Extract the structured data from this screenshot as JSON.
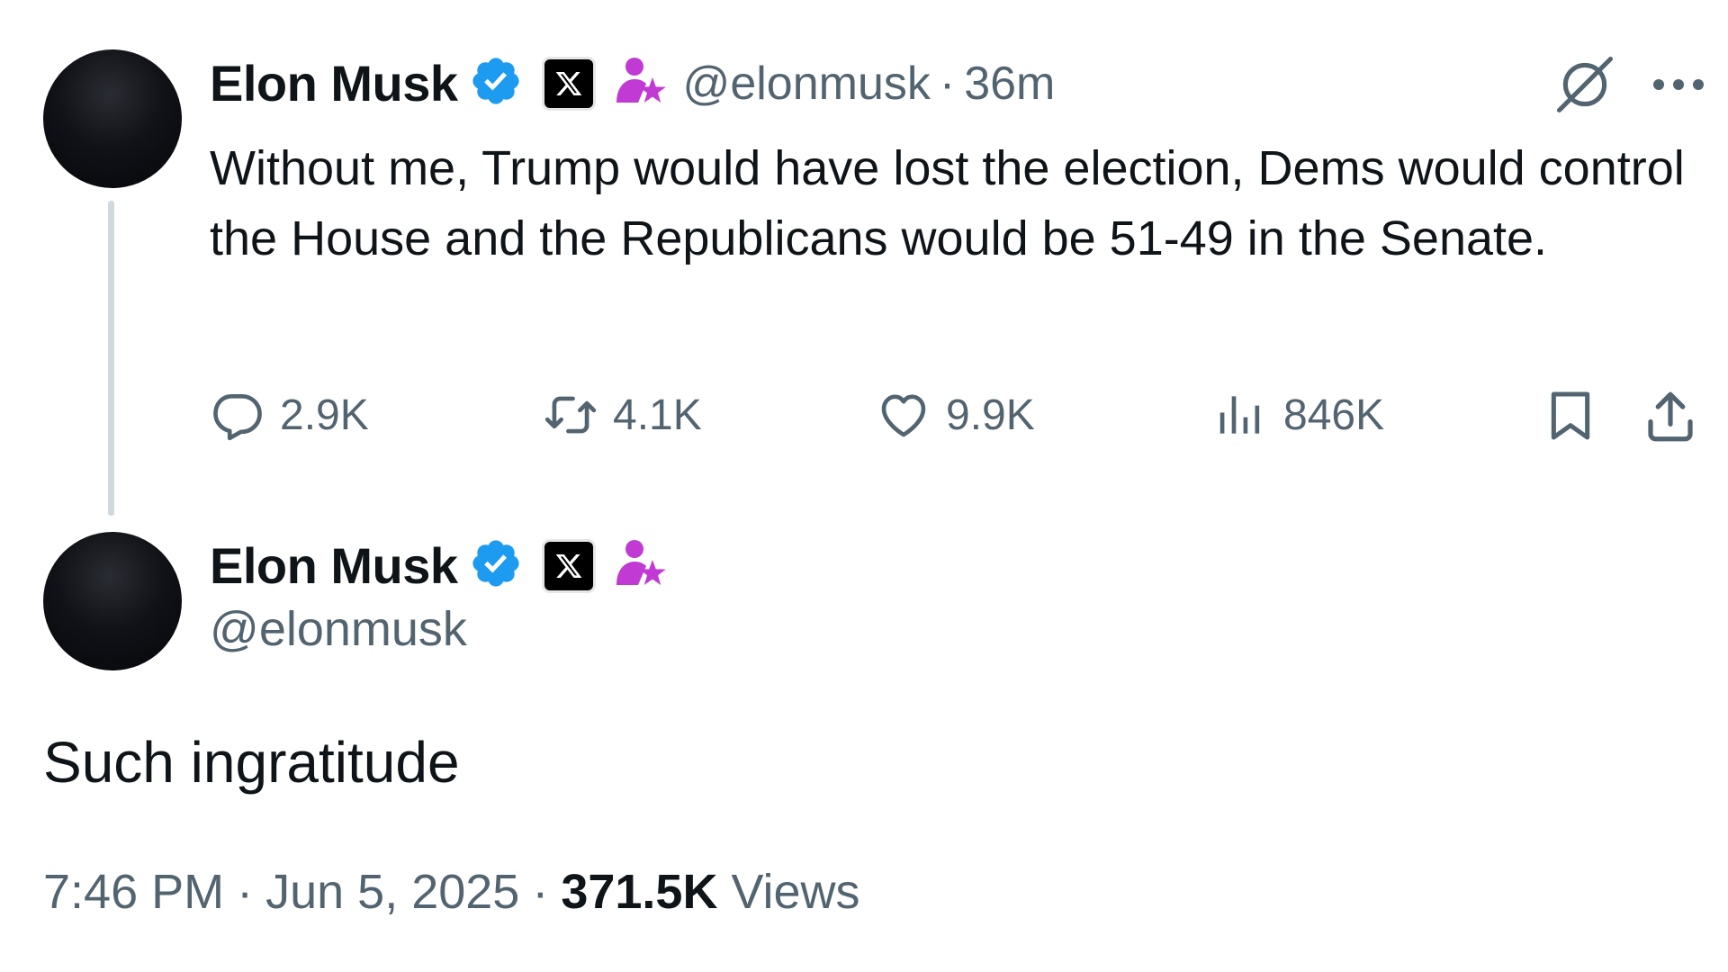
{
  "reply_tweet": {
    "author": {
      "display_name": "Elon Musk",
      "handle": "@elonmusk",
      "verified_icon": "verified-badge-icon",
      "affiliate_icon": "x-logo-icon",
      "role_icon": "person-star-icon"
    },
    "time": "36m",
    "separator": "·",
    "text": "Without me, Trump would have lost the election, Dems would control the House and the Republicans would be 51-49 in the Senate.",
    "stats": {
      "replies": "2.9K",
      "reposts": "4.1K",
      "likes": "9.9K",
      "views": "846K"
    },
    "icons": {
      "grok": "grok-icon",
      "more": "more-icon",
      "reply": "reply-icon",
      "repost": "repost-icon",
      "like": "heart-icon",
      "views": "views-icon",
      "bookmark": "bookmark-icon",
      "share": "share-icon"
    }
  },
  "main_tweet": {
    "author": {
      "display_name": "Elon Musk",
      "handle": "@elonmusk"
    },
    "text": "Such ingratitude",
    "time": "7:46 PM",
    "date": "Jun 5, 2025",
    "separator": "·",
    "views_count": "371.5K",
    "views_label": "Views"
  },
  "colors": {
    "text_primary": "#0f1419",
    "text_secondary": "#536471",
    "verified_blue": "#1d9bf0",
    "affiliate_pink": "#c03ad3",
    "thread_line": "#cfd9de"
  }
}
